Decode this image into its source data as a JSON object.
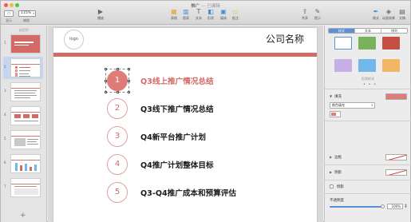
{
  "window": {
    "title": "推广",
    "edited": "— 已编辑"
  },
  "toolbar": {
    "view_label": "显示",
    "zoom_value": "115%",
    "zoom_label": "缩放",
    "play_label": "播放",
    "table_label": "表格",
    "chart_label": "图表",
    "text_label": "文本",
    "shape_label": "形状",
    "media_label": "媒体",
    "comment_label": "批注",
    "share_label": "共享",
    "tips_label": "提示",
    "format_label": "格式",
    "animate_label": "动画效果",
    "document_label": "文稿",
    "play_icon": "play-icon"
  },
  "navigator": {
    "header": "幻灯片",
    "slides": [
      {
        "number": "1",
        "selected": false
      },
      {
        "number": "2",
        "selected": true
      },
      {
        "number": "3",
        "selected": false
      },
      {
        "number": "4",
        "selected": false
      },
      {
        "number": "5",
        "selected": false
      },
      {
        "number": "6",
        "selected": false
      },
      {
        "number": "7",
        "selected": false
      }
    ],
    "add_label": "+"
  },
  "slide": {
    "logo": "logo",
    "company": "公司名称",
    "accent_color": "#d36a66",
    "items": [
      {
        "num": "1",
        "text": "Q3线上推广情况总结",
        "selected": true
      },
      {
        "num": "2",
        "text": "Q3线下推广情况总结",
        "selected": false
      },
      {
        "num": "3",
        "text": "Q4新平台推广计划",
        "selected": false
      },
      {
        "num": "4",
        "text": "Q4推广计划整体目标",
        "selected": false
      },
      {
        "num": "5",
        "text": "Q3-Q4推广成本和预算评估",
        "selected": false
      }
    ]
  },
  "inspector": {
    "tabs": [
      "样式",
      "文本",
      "排列"
    ],
    "active_tab": "样式",
    "style_label": "形状样式",
    "pager": "• • •",
    "fill_label": "填充",
    "fill_color": "#e07c77",
    "fill_type": "颜色填充",
    "border_label": "边框",
    "shadow_label": "阴影",
    "reflection_label": "倒影",
    "opacity_label": "不透明度",
    "opacity_value": "100%"
  }
}
